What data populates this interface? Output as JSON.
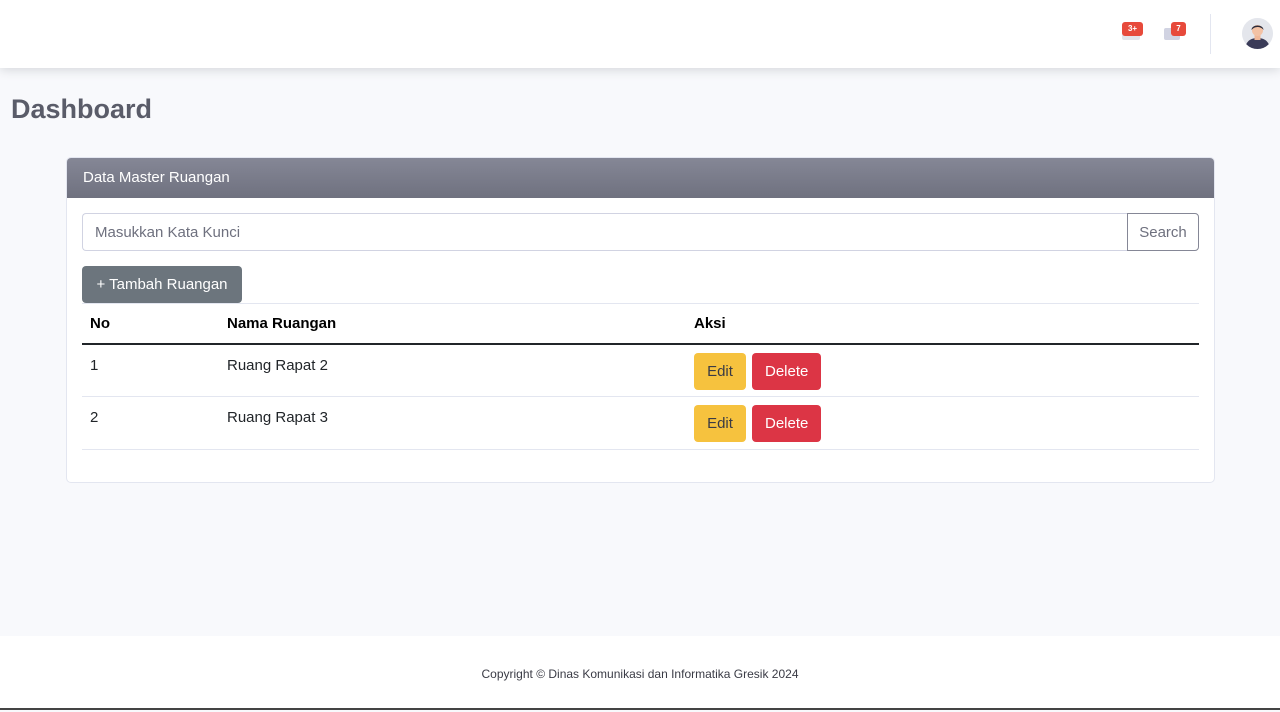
{
  "topbar": {
    "alerts_badge": "3+",
    "messages_badge": "7",
    "alerts_icon": "bell-icon",
    "messages_icon": "envelope-icon",
    "avatar_icon": "user-avatar-icon"
  },
  "page": {
    "title": "Dashboard"
  },
  "card": {
    "header": "Data Master Ruangan",
    "search": {
      "placeholder": "Masukkan Kata Kunci",
      "value": "",
      "button_label": "Search"
    },
    "add_button_label": "+ Tambah Ruangan",
    "table": {
      "columns": [
        "No",
        "Nama Ruangan",
        "Aksi"
      ],
      "rows": [
        {
          "no": "1",
          "nama": "Ruang Rapat 2",
          "edit_label": "Edit",
          "delete_label": "Delete"
        },
        {
          "no": "2",
          "nama": "Ruang Rapat 3",
          "edit_label": "Edit",
          "delete_label": "Delete"
        }
      ]
    }
  },
  "footer": {
    "text": "Copyright © Dinas Komunikasi dan Informatika Gresik 2024"
  },
  "colors": {
    "edit": "#f6c23e",
    "delete": "#dc3545",
    "secondary": "#6c757d",
    "badge": "#e74a3b",
    "card_header": "#858796"
  }
}
